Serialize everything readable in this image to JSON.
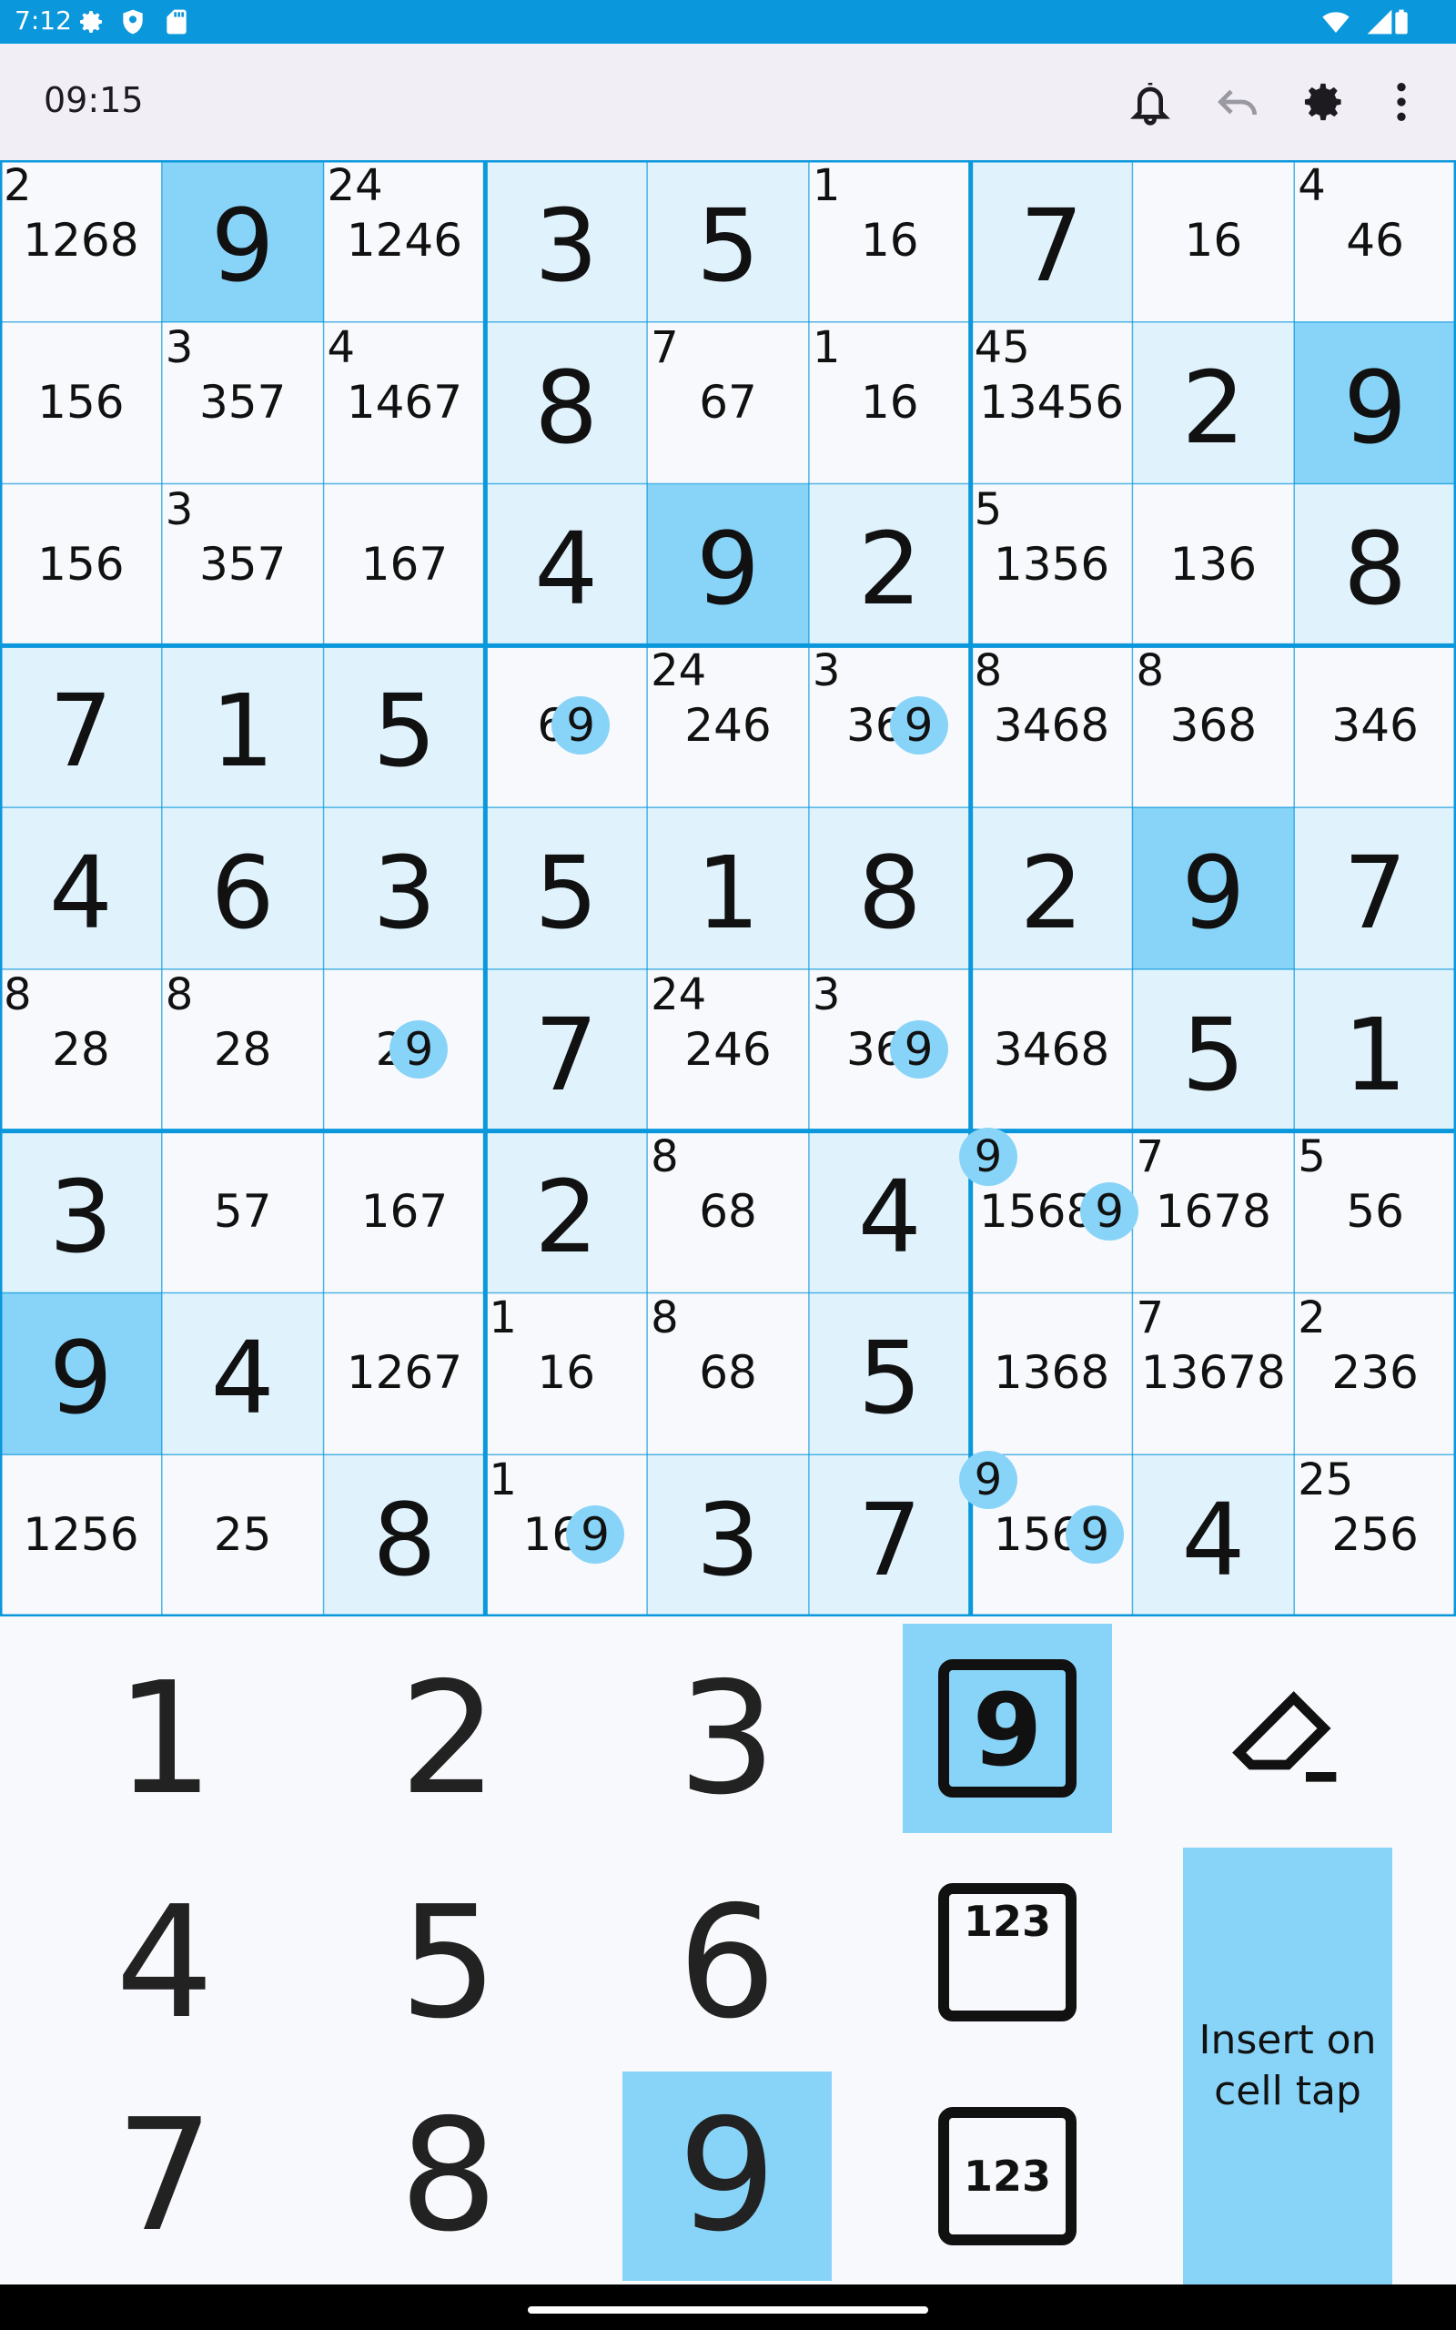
{
  "status_bar": {
    "time": "7:12"
  },
  "toolbar": {
    "timer": "09:15"
  },
  "board": {
    "colors": {
      "highlight": "#e0f3fd",
      "selected": "#88d4f8",
      "grid": "#0a97db"
    },
    "cells": [
      [
        {
          "c": "2",
          "n": "1268"
        },
        {
          "v": "9",
          "s": "sel"
        },
        {
          "c": "24",
          "n": "1246"
        },
        {
          "v": "3",
          "s": "hl"
        },
        {
          "v": "5",
          "s": "hl"
        },
        {
          "c": "1",
          "n": "16"
        },
        {
          "v": "7",
          "s": "hl"
        },
        {
          "n": "16"
        },
        {
          "c": "4",
          "n": "46"
        }
      ],
      [
        {
          "n": "156"
        },
        {
          "c": "3",
          "n": "357"
        },
        {
          "c": "4",
          "n": "1467"
        },
        {
          "v": "8",
          "s": "hl"
        },
        {
          "c": "7",
          "n": "67"
        },
        {
          "c": "1",
          "n": "16"
        },
        {
          "c": "45",
          "n": "13456"
        },
        {
          "v": "2",
          "s": "hl"
        },
        {
          "v": "9",
          "s": "sel"
        }
      ],
      [
        {
          "n": "156"
        },
        {
          "c": "3",
          "n": "357"
        },
        {
          "n": "167"
        },
        {
          "v": "4",
          "s": "hl"
        },
        {
          "v": "9",
          "s": "sel"
        },
        {
          "v": "2",
          "s": "hl"
        },
        {
          "c": "5",
          "n": "1356"
        },
        {
          "n": "136"
        },
        {
          "v": "8",
          "s": "hl"
        }
      ],
      [
        {
          "v": "7",
          "s": "hl"
        },
        {
          "v": "1",
          "s": "hl"
        },
        {
          "v": "5",
          "s": "hl"
        },
        {
          "n": "69"
        },
        {
          "c": "24",
          "n": "246"
        },
        {
          "c": "3",
          "n": "369"
        },
        {
          "c": "8",
          "n": "3468"
        },
        {
          "c": "8",
          "n": "368"
        },
        {
          "n": "346"
        }
      ],
      [
        {
          "v": "4",
          "s": "hl"
        },
        {
          "v": "6",
          "s": "hl"
        },
        {
          "v": "3",
          "s": "hl"
        },
        {
          "v": "5",
          "s": "hl"
        },
        {
          "v": "1",
          "s": "hl"
        },
        {
          "v": "8",
          "s": "hl"
        },
        {
          "v": "2",
          "s": "hl"
        },
        {
          "v": "9",
          "s": "sel"
        },
        {
          "v": "7",
          "s": "hl"
        }
      ],
      [
        {
          "c": "8",
          "n": "28"
        },
        {
          "c": "8",
          "n": "28"
        },
        {
          "n": "29"
        },
        {
          "v": "7",
          "s": "hl"
        },
        {
          "c": "24",
          "n": "246"
        },
        {
          "c": "3",
          "n": "369"
        },
        {
          "n": "3468"
        },
        {
          "v": "5",
          "s": "hl"
        },
        {
          "v": "1",
          "s": "hl"
        }
      ],
      [
        {
          "v": "3",
          "s": "hl"
        },
        {
          "n": "57"
        },
        {
          "n": "167"
        },
        {
          "v": "2",
          "s": "hl"
        },
        {
          "c": "8",
          "n": "68"
        },
        {
          "v": "4",
          "s": "hl"
        },
        {
          "c": "9",
          "n": "15689"
        },
        {
          "c": "7",
          "n": "1678"
        },
        {
          "c": "5",
          "n": "56"
        }
      ],
      [
        {
          "v": "9",
          "s": "sel"
        },
        {
          "v": "4",
          "s": "hl"
        },
        {
          "n": "1267"
        },
        {
          "c": "1",
          "n": "16"
        },
        {
          "c": "8",
          "n": "68"
        },
        {
          "v": "5",
          "s": "hl"
        },
        {
          "n": "1368"
        },
        {
          "c": "7",
          "n": "13678"
        },
        {
          "c": "2",
          "n": "236"
        }
      ],
      [
        {
          "n": "1256"
        },
        {
          "n": "25"
        },
        {
          "v": "8",
          "s": "hl"
        },
        {
          "c": "1",
          "n": "169"
        },
        {
          "v": "3",
          "s": "hl"
        },
        {
          "v": "7",
          "s": "hl"
        },
        {
          "c": "9",
          "n": "1569"
        },
        {
          "v": "4",
          "s": "hl"
        },
        {
          "c": "25",
          "n": "256"
        }
      ]
    ]
  },
  "keypad": {
    "digits": [
      "1",
      "2",
      "3",
      "4",
      "5",
      "6",
      "7",
      "8",
      "9"
    ],
    "selected_digit": "9",
    "mode_value_label": "9",
    "mode_corner_label": "123",
    "mode_center_label": "123",
    "insert_tap_label": "Insert on cell tap"
  }
}
